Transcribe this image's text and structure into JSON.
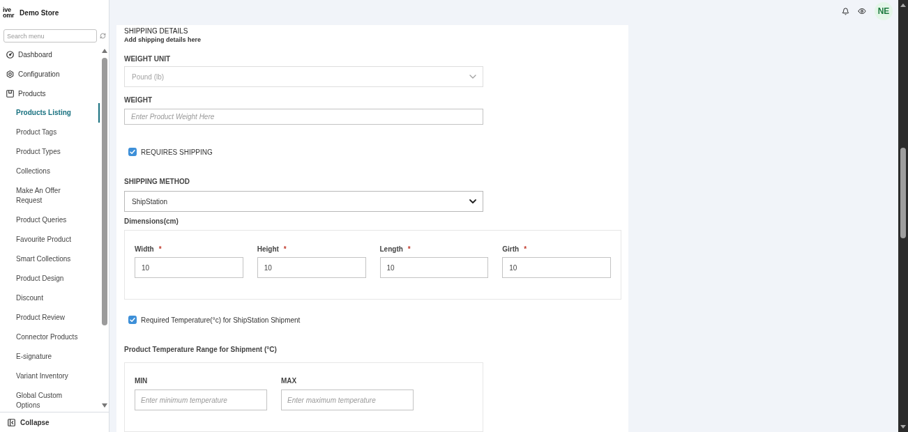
{
  "sidebar": {
    "logo": {
      "line_1": "ive",
      "line_2": "omr"
    },
    "store_name": "Demo Store",
    "search": {
      "placeholder": "Search menu"
    },
    "items": [
      {
        "label": "Dashboard",
        "selected": false
      },
      {
        "label": "Configuration",
        "selected": false
      },
      {
        "label": "Products",
        "selected": false,
        "children": [
          {
            "label": "Products Listing",
            "selected": true
          },
          {
            "label": "Product Tags",
            "selected": false
          },
          {
            "label": "Product Types",
            "selected": false
          },
          {
            "label": "Collections",
            "selected": false
          },
          {
            "label": "Make An Offer Request",
            "selected": false
          },
          {
            "label": "Product Queries",
            "selected": false
          },
          {
            "label": "Favourite Product",
            "selected": false
          },
          {
            "label": "Smart Collections",
            "selected": false
          },
          {
            "label": "Product Design",
            "selected": false
          },
          {
            "label": "Discount",
            "selected": false
          },
          {
            "label": "Product Review",
            "selected": false
          },
          {
            "label": "Connector Products",
            "selected": false
          },
          {
            "label": "E-signature",
            "selected": false
          },
          {
            "label": "Variant Inventory",
            "selected": false
          },
          {
            "label": "Global Custom Options",
            "selected": false
          }
        ]
      }
    ],
    "collapse": {
      "label": "Collapse"
    }
  },
  "header": {
    "avatar": {
      "initials": "NE"
    }
  },
  "form": {
    "title": "SHIPPING DETAILS",
    "subtitle": "Add shipping details here",
    "weight_unit": {
      "label": "WEIGHT UNIT",
      "value": "Pound (lb)",
      "disabled": true
    },
    "weight": {
      "label": "WEIGHT",
      "placeholder": "Enter Product Weight Here"
    },
    "requires_shipping": {
      "label": "REQUIRES SHIPPING",
      "checked": true
    },
    "shipping_method": {
      "label": "SHIPPING METHOD",
      "value": "ShipStation",
      "disabled": false
    },
    "dimensions": {
      "title": "Dimensions(cm)",
      "fields": [
        {
          "label": "Width",
          "required_mark": "*",
          "value": "10"
        },
        {
          "label": "Height",
          "required_mark": "*",
          "value": "10"
        },
        {
          "label": "Length",
          "required_mark": "*",
          "value": "10"
        },
        {
          "label": "Girth",
          "required_mark": "*",
          "value": "10"
        }
      ]
    },
    "required_temperature": {
      "label": "Required Temperature(°c) for ShipStation Shipment",
      "checked": true
    },
    "temperature_range": {
      "title": "Product Temperature Range for Shipment (°C)",
      "fields": [
        {
          "label": "MIN",
          "placeholder": "Enter minimum temperature"
        },
        {
          "label": "MAX",
          "placeholder": "Enter maximum temperature"
        }
      ]
    }
  }
}
